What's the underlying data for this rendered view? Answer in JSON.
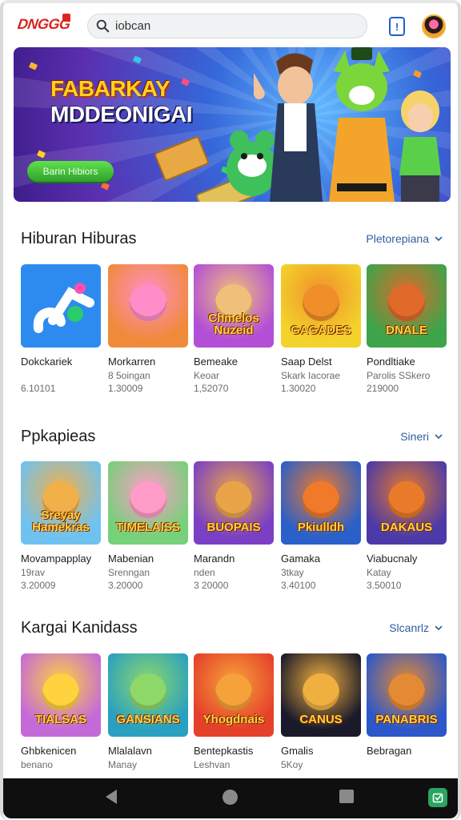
{
  "header": {
    "logo_text": "DNGGG",
    "search": {
      "value": "iobcan",
      "placeholder": ""
    },
    "notification_glyph": "!"
  },
  "banner": {
    "title_line1": "FABARKAY",
    "title_line2": "MDDEONIGAI",
    "cta_label": "Barin Hibiors"
  },
  "sections": [
    {
      "title": "Hiburan Hiburas",
      "more_label": "Pletorepiana",
      "apps": [
        {
          "name": "Dokckariek",
          "sub": "",
          "count": "6.10101",
          "tile_label": "",
          "colors": [
            "#2d8bf0",
            "#ffffff"
          ]
        },
        {
          "name": "Morkarren",
          "sub": "8 5oingan",
          "count": "1.30009",
          "tile_label": "",
          "colors": [
            "#f08a3a",
            "#ff8ec8"
          ]
        },
        {
          "name": "Bemeake",
          "sub": "Keoar",
          "count": "1,52070",
          "tile_label": "Chmelos Nuzeid",
          "colors": [
            "#b34fd6",
            "#f0c07a"
          ]
        },
        {
          "name": "Saap Delst",
          "sub": "Skark Iacorae",
          "count": "1.30020",
          "tile_label": "GAGADES",
          "colors": [
            "#f3d22a",
            "#f08f2a"
          ]
        },
        {
          "name": "Pondltiake",
          "sub": "Parolis SSkero",
          "count": "219000",
          "tile_label": "DNALE",
          "colors": [
            "#3da44a",
            "#e06a2a"
          ]
        }
      ]
    },
    {
      "title": "Ppkapieas",
      "more_label": "Sineri",
      "apps": [
        {
          "name": "Movampapplay",
          "sub": "19rav",
          "count": "3.20009",
          "tile_label": "Sreyay Hamekras",
          "colors": [
            "#6fc2f0",
            "#f2b04a"
          ]
        },
        {
          "name": "Mabenian",
          "sub": "Srenngan",
          "count": "3.20000",
          "tile_label": "TIMELAISS",
          "colors": [
            "#77d07a",
            "#ff9cc8"
          ]
        },
        {
          "name": "Marandn",
          "sub": "nden",
          "count": "3 20000",
          "tile_label": "BUOPAIS",
          "colors": [
            "#7a3fc4",
            "#e9a44a"
          ]
        },
        {
          "name": "Gamaka",
          "sub": "3tkay",
          "count": "3.40100",
          "tile_label": "Pkiulldh",
          "colors": [
            "#2b5fc9",
            "#f07a2a"
          ]
        },
        {
          "name": "Viabucnaly",
          "sub": "Katay",
          "count": "3.50010",
          "tile_label": "DAKAUS",
          "colors": [
            "#4b3aa8",
            "#e87a2a"
          ]
        }
      ]
    },
    {
      "title": "Kargai Kanidass",
      "more_label": "Slcanrlz",
      "apps": [
        {
          "name": "Ghbkenicen",
          "sub": "benano",
          "count": "",
          "tile_label": "TIALSAS",
          "colors": [
            "#c46ad8",
            "#ffd23f"
          ]
        },
        {
          "name": "Mlalalavn",
          "sub": "Manay",
          "count": "",
          "tile_label": "GANSIANS",
          "colors": [
            "#2aa0c0",
            "#8ed86a"
          ]
        },
        {
          "name": "Bentepkastis",
          "sub": "Leshvan",
          "count": "",
          "tile_label": "Yhogdnais",
          "colors": [
            "#e5402a",
            "#f6a23a"
          ]
        },
        {
          "name": "Gmalis",
          "sub": "5Koy",
          "count": "",
          "tile_label": "CANUS",
          "colors": [
            "#1a1a2a",
            "#f0b040"
          ]
        },
        {
          "name": "Bebragan",
          "sub": "",
          "count": "",
          "tile_label": "PANABRIS",
          "colors": [
            "#2c57c9",
            "#e58a34"
          ]
        }
      ]
    }
  ]
}
